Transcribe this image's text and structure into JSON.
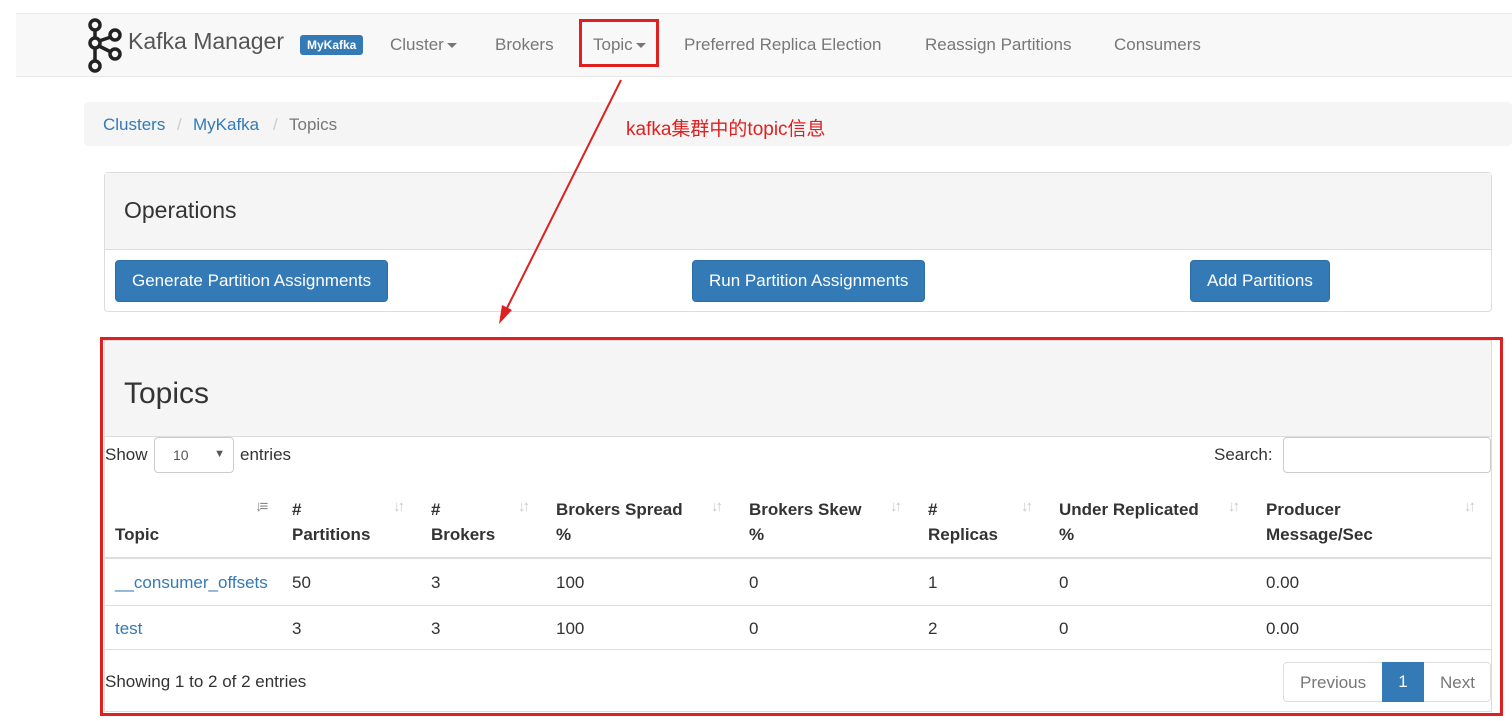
{
  "navbar": {
    "brand": "Kafka Manager",
    "cluster_badge": "MyKafka",
    "items": [
      "Cluster",
      "Brokers",
      "Topic",
      "Preferred Replica Election",
      "Reassign Partitions",
      "Consumers"
    ]
  },
  "breadcrumb": [
    "Clusters",
    "MyKafka",
    "Topics"
  ],
  "annotation": "kafka集群中的topic信息",
  "operations": {
    "title": "Operations",
    "buttons": [
      "Generate Partition Assignments",
      "Run Partition Assignments",
      "Add Partitions"
    ]
  },
  "topics": {
    "title": "Topics",
    "show_label": "Show",
    "length_value": "10",
    "entries_label": "entries",
    "search_label": "Search:",
    "search_value": "",
    "columns": [
      [
        "",
        "Topic"
      ],
      [
        "#",
        "Partitions"
      ],
      [
        "#",
        "Brokers"
      ],
      [
        "Brokers Spread",
        "%"
      ],
      [
        "Brokers Skew",
        "%"
      ],
      [
        "#",
        "Replicas"
      ],
      [
        "Under Replicated",
        "%"
      ],
      [
        "Producer",
        "Message/Sec"
      ]
    ],
    "rows": [
      [
        "__consumer_offsets",
        "50",
        "3",
        "100",
        "0",
        "1",
        "0",
        "0.00"
      ],
      [
        "test",
        "3",
        "3",
        "100",
        "0",
        "2",
        "0",
        "0.00"
      ]
    ],
    "info": "Showing 1 to 2 of 2 entries",
    "pagination": {
      "previous": "Previous",
      "current": "1",
      "next": "Next"
    }
  },
  "colors": {
    "primary": "#337ab7",
    "annotation_red": "#e02020"
  }
}
